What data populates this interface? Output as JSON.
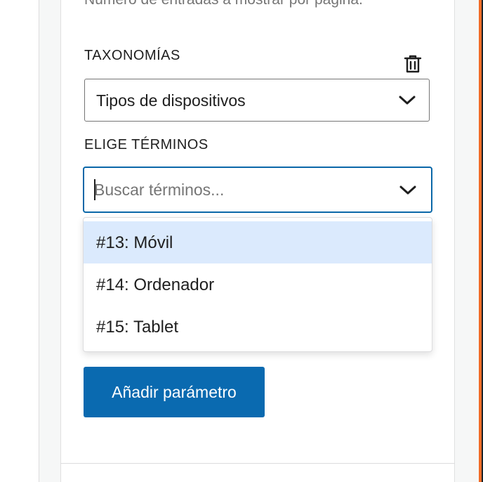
{
  "help_text": "Número de entradas a mostrar por página.",
  "taxonomies": {
    "label": "TAXONOMÍAS",
    "selected": "Tipos de dispositivos",
    "delete_icon": "trash-icon"
  },
  "terms": {
    "label": "ELIGE TÉRMINOS",
    "search_placeholder": "Buscar términos...",
    "search_value": "",
    "options": [
      {
        "label": "#13: Móvil",
        "highlighted": true
      },
      {
        "label": "#14: Ordenador",
        "highlighted": false
      },
      {
        "label": "#15: Tablet",
        "highlighted": false
      }
    ]
  },
  "add_button_label": "Añadir parámetro",
  "colors": {
    "primary": "#0a6ab0",
    "focus_border": "#0a67a8",
    "highlight": "#dbeafd",
    "accent_orange": "#f56e28"
  }
}
